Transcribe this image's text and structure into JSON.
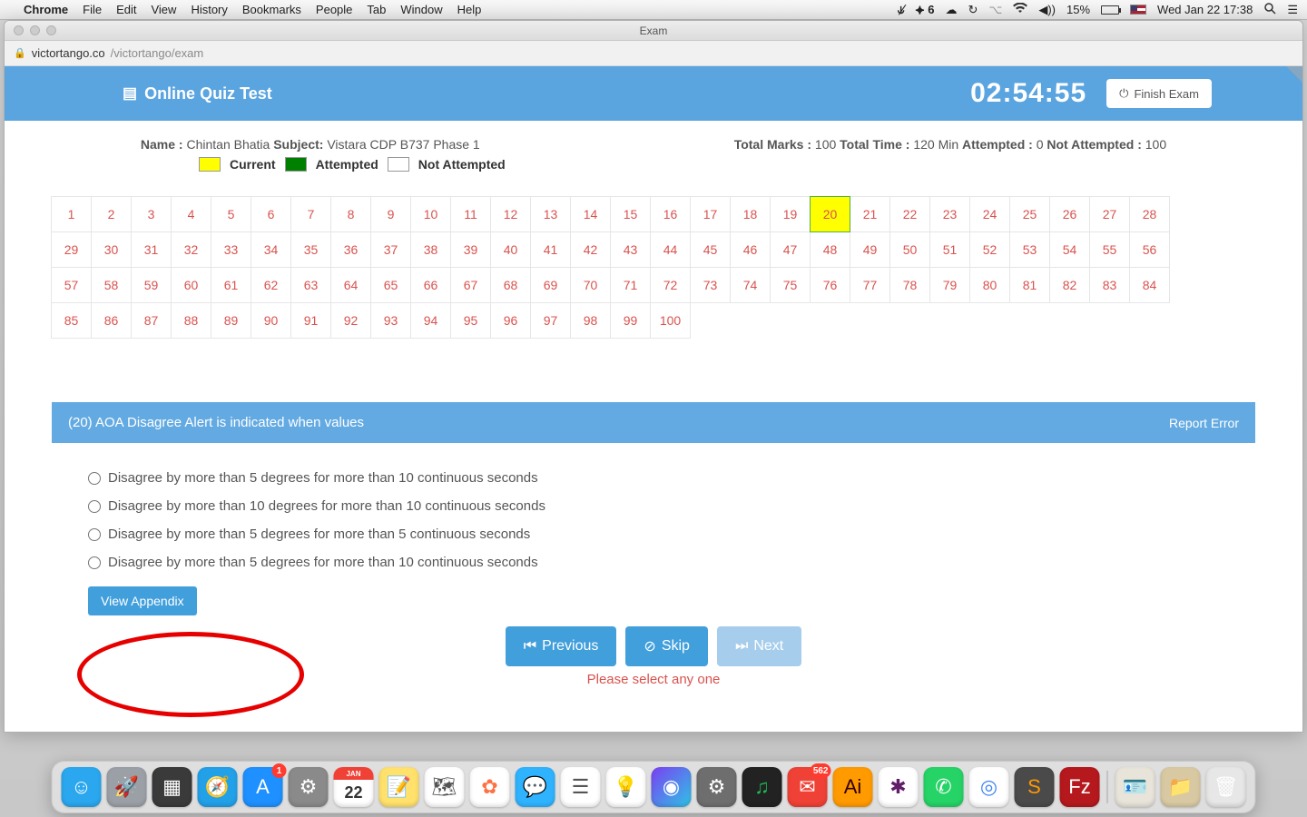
{
  "menubar": {
    "app": "Chrome",
    "menus": [
      "File",
      "Edit",
      "View",
      "History",
      "Bookmarks",
      "People",
      "Tab",
      "Window",
      "Help"
    ],
    "right_items": [
      "✶",
      "⌥",
      "6",
      "☁",
      "↻",
      "⋮",
      "🔵",
      "⫴",
      "◍))",
      "15%",
      "🔋",
      "🇺🇸"
    ],
    "battery_pct": "15%",
    "datetime": "Wed Jan 22  17:38"
  },
  "window": {
    "title": "Exam",
    "domain": "victortango.co",
    "path": "/victortango/exam"
  },
  "header": {
    "title": "Online Quiz Test",
    "timer": "02:54:55",
    "finish_label": "Finish Exam"
  },
  "info": {
    "name_label": "Name :",
    "name_value": "Chintan Bhatia",
    "subject_label": "Subject:",
    "subject_value": "Vistara CDP B737 Phase 1",
    "marks_label": "Total Marks :",
    "marks_value": "100",
    "time_label": "Total Time :",
    "time_value": "120 Min",
    "attempted_label": "Attempted :",
    "attempted_value": "0",
    "notatt_label": "Not Attempted :",
    "notatt_value": "100"
  },
  "legend": {
    "current": "Current",
    "attempted": "Attempted",
    "notattempted": "Not Attempted"
  },
  "grid": {
    "total": 100,
    "current": 20
  },
  "question": {
    "heading": "(20) AOA Disagree Alert is indicated when values",
    "report_error": "Report Error",
    "options": [
      "Disagree by more than 5 degrees for more than 10 continuous seconds",
      "Disagree by more than 10 degrees for more than 10 continuous seconds",
      "Disagree by more than 5 degrees for more than 5 continuous seconds",
      "Disagree by more than 5 degrees for more than 10 continuous seconds"
    ],
    "appendix_label": "View Appendix"
  },
  "nav": {
    "previous": "Previous",
    "skip": "Skip",
    "next": "Next",
    "warning": "Please select any one"
  },
  "dock": {
    "items": [
      {
        "name": "finder",
        "bg": "#2aa7ee",
        "glyph": "☺"
      },
      {
        "name": "launchpad",
        "bg": "#9aa0a6",
        "glyph": "🚀"
      },
      {
        "name": "mission",
        "bg": "#3a3a3a",
        "glyph": "▦"
      },
      {
        "name": "safari",
        "bg": "#22a0e8",
        "glyph": "🧭"
      },
      {
        "name": "appstore",
        "bg": "#1e90ff",
        "glyph": "A",
        "badge": "1"
      },
      {
        "name": "systemprefs",
        "bg": "#8a8a8a",
        "glyph": "⚙"
      },
      {
        "name": "calendar",
        "bg": "#ffffff",
        "glyph": "22",
        "text": "#e04040"
      },
      {
        "name": "notes",
        "bg": "#ffe16b",
        "glyph": "📝"
      },
      {
        "name": "maps",
        "bg": "#ffffff",
        "glyph": "🗺"
      },
      {
        "name": "photos",
        "bg": "#ffffff",
        "glyph": "✿",
        "text": "#ff7043"
      },
      {
        "name": "messages",
        "bg": "#2fb3ff",
        "glyph": "💬"
      },
      {
        "name": "reminders",
        "bg": "#ffffff",
        "glyph": "☰",
        "text": "#555"
      },
      {
        "name": "lightbulb",
        "bg": "#ffffff",
        "glyph": "💡"
      },
      {
        "name": "siri",
        "bg": "linear-gradient(135deg,#7b3ff2,#2ec4e6)",
        "glyph": "◉"
      },
      {
        "name": "settings2",
        "bg": "#6e6e6e",
        "glyph": "⚙"
      },
      {
        "name": "spotify",
        "bg": "#222",
        "glyph": "♫",
        "text": "#1db954"
      },
      {
        "name": "mail-red",
        "bg": "#ef4136",
        "glyph": "✉",
        "badge": "562"
      },
      {
        "name": "illustrator",
        "bg": "#ff9a00",
        "glyph": "Ai",
        "text": "#330000"
      },
      {
        "name": "slack",
        "bg": "#ffffff",
        "glyph": "✱",
        "text": "#611f69"
      },
      {
        "name": "whatsapp",
        "bg": "#25d366",
        "glyph": "✆"
      },
      {
        "name": "chrome",
        "bg": "#ffffff",
        "glyph": "◎",
        "text": "#4285f4"
      },
      {
        "name": "sublime",
        "bg": "#4a4a4a",
        "glyph": "S",
        "text": "#ff9800"
      },
      {
        "name": "filezilla",
        "bg": "#b5191d",
        "glyph": "Fz"
      }
    ],
    "items2": [
      {
        "name": "id",
        "bg": "#e8e4da",
        "glyph": "🪪"
      },
      {
        "name": "folder",
        "bg": "#d9c9a3",
        "glyph": "📁"
      },
      {
        "name": "trash",
        "bg": "#e7e7e7",
        "glyph": "🗑"
      }
    ]
  }
}
